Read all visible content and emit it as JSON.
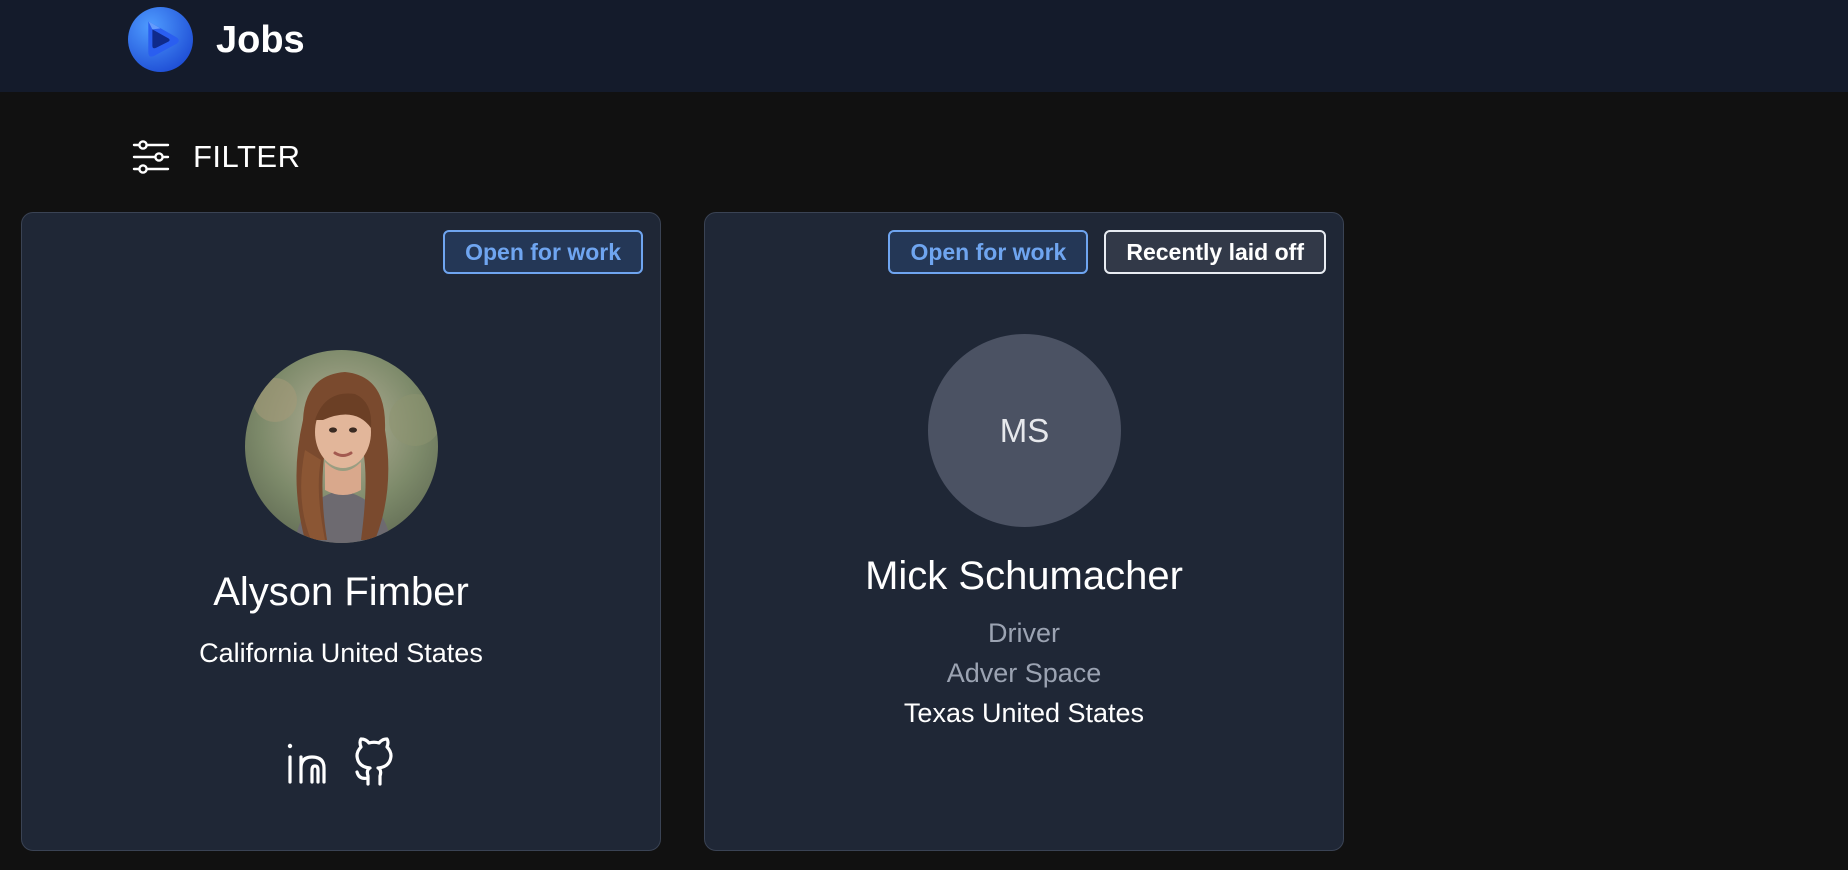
{
  "header": {
    "title": "Jobs",
    "logo_icon": "play-logo-icon",
    "background": "#141b2b"
  },
  "filter": {
    "label": "FILTER",
    "icon": "sliders-icon"
  },
  "cards": [
    {
      "badges": [
        "Open for work"
      ],
      "avatar": {
        "type": "photo"
      },
      "name": "Alyson Fimber",
      "location": "California United States",
      "socials": [
        "linkedin-icon",
        "github-icon"
      ]
    },
    {
      "badges": [
        "Open for work",
        "Recently laid off"
      ],
      "avatar": {
        "type": "initials",
        "initials": "MS"
      },
      "name": "Mick Schumacher",
      "role": "Driver",
      "company": "Adver Space",
      "location": "Texas United States"
    }
  ],
  "colors": {
    "page_bg": "#111111",
    "card_bg": "#1f2736",
    "accent_blue": "#6fa5f0",
    "muted_text": "#9ba3b2"
  }
}
